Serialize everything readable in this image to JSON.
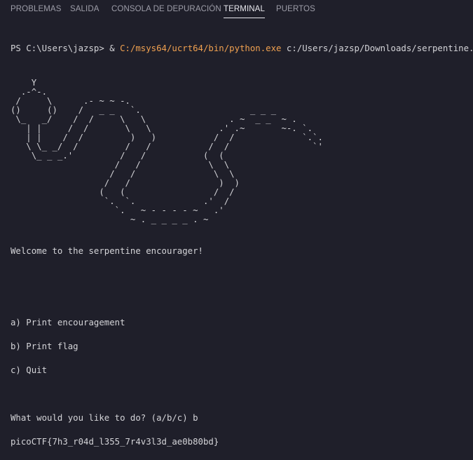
{
  "panel": {
    "tabs": [
      {
        "label": "PROBLEMAS"
      },
      {
        "label": "SALIDA"
      },
      {
        "label": "CONSOLA DE DEPURACIÓN"
      },
      {
        "label": "TERMINAL"
      },
      {
        "label": "PUERTOS"
      }
    ],
    "active_tab": "TERMINAL"
  },
  "terminal": {
    "prompt": "PS C:\\Users\\jazsp> ",
    "call_operator": "& ",
    "interpreter": "C:/msys64/ucrt64/bin/python.exe",
    "script_arg": " c:/Users/jazsp/Downloads/serpentine.py",
    "ascii_art": "    Y\n  .-^-.\n /     \\      .- ~ ~ -.\n()     ()    /   _ _   `.                     _ _ _\n \\_   _/    /  /     \\   \\                . ~  _ _  ~ .\n   | |     /  /       \\   \\             .' .~       ~-. `.\n   | |    /  /         )   )           /  /             `.`.\n   \\ \\_ _/  /         /   /           /  /                `'\n    \\_ _ _.'         /   /           (  (\n                    /   /             \\  \\\n                   /   /               \\  \\\n                  /   /                 )  )\n                 (   (                 /  /\n                  `.  `.             .'  /\n                    `.   ~ - - - - ~   .'\n                       ~ . _ _ _ _ . ~",
    "welcome": "Welcome to the serpentine encourager!",
    "menu": [
      "a) Print encouragement",
      "b) Print flag",
      "c) Quit"
    ],
    "question": "What would you like to do? (a/b/c) b",
    "flag": "picoCTF{7h3_r04d_l355_7r4v3l3d_ae0b80bd}"
  }
}
